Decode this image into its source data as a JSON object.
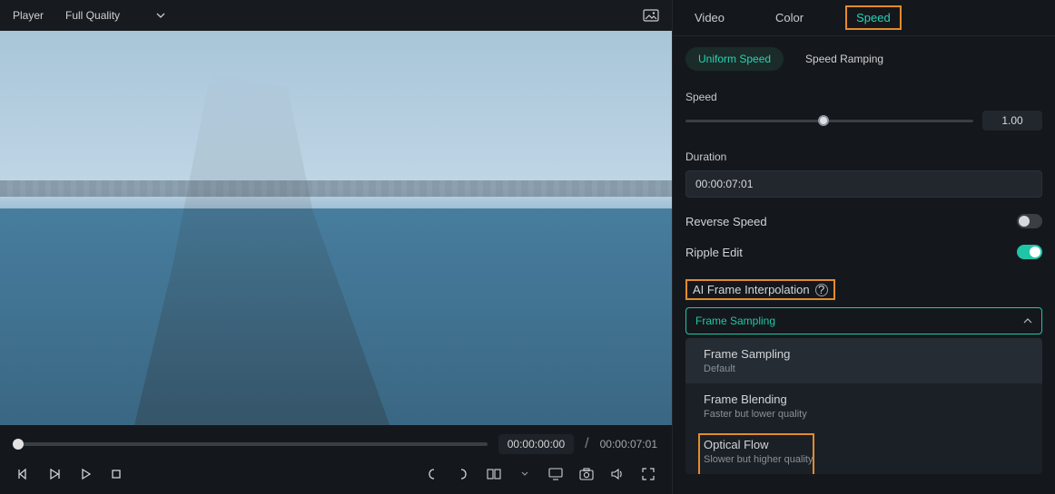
{
  "player": {
    "label": "Player",
    "quality": "Full Quality",
    "current_time": "00:00:00:00",
    "total_time": "00:00:07:01"
  },
  "tabs": [
    "Video",
    "Color",
    "Speed"
  ],
  "active_tab": 2,
  "segmented": {
    "options": [
      "Uniform Speed",
      "Speed Ramping"
    ],
    "active": 0
  },
  "speed": {
    "label": "Speed",
    "value": "1.00"
  },
  "duration": {
    "label": "Duration",
    "value": "00:00:07:01"
  },
  "reverse": {
    "label": "Reverse Speed",
    "on": false
  },
  "ripple": {
    "label": "Ripple Edit",
    "on": true
  },
  "interpolation": {
    "label": "AI Frame Interpolation",
    "selected": "Frame Sampling",
    "options": [
      {
        "title": "Frame Sampling",
        "subtitle": "Default"
      },
      {
        "title": "Frame Blending",
        "subtitle": "Faster but lower quality"
      },
      {
        "title": "Optical Flow",
        "subtitle": "Slower but higher quality"
      }
    ]
  }
}
